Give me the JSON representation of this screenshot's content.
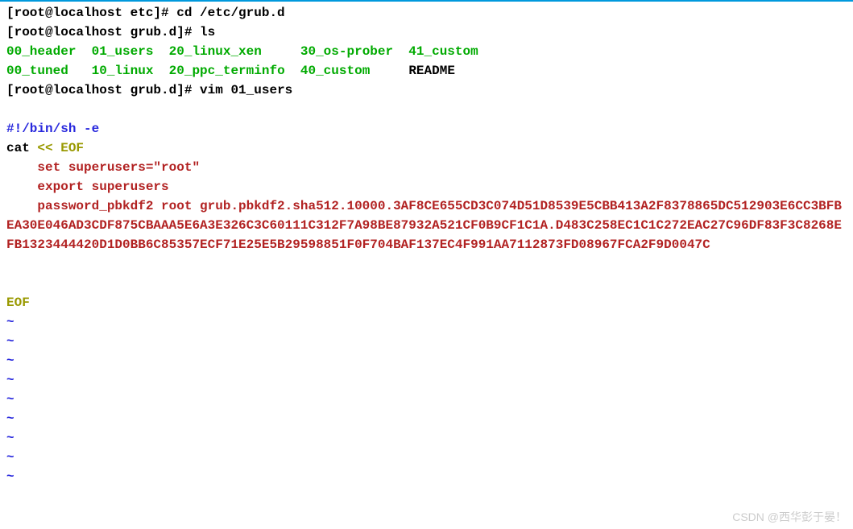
{
  "prompts": {
    "line1_prompt": "[root@localhost etc]# ",
    "line1_cmd": "cd /etc/grub.d",
    "line2_prompt": "[root@localhost grub.d]# ",
    "line2_cmd": "ls",
    "line5_prompt": "[root@localhost grub.d]# ",
    "line5_cmd": "vim 01_users"
  },
  "ls_output": {
    "row1_col1": "00_header",
    "row1_col2": "01_users",
    "row1_col3": "20_linux_xen",
    "row1_col4": "30_os-prober",
    "row1_col5": "41_custom",
    "row2_col1": "00_tuned",
    "row2_col2": "10_linux",
    "row2_col3": "20_ppc_terminfo",
    "row2_col4": "40_custom",
    "row2_col5": "README"
  },
  "file": {
    "shebang": "#!/bin/sh -e",
    "cat": "cat ",
    "heredoc_start": "<< EOF",
    "line1": "    set superusers=\"root\"",
    "line2": "    export superusers",
    "hash_wrapped": "    password_pbkdf2 root grub.pbkdf2.sha512.10000.3AF8CE655CD3C074D51D8539E5CBB413A2F8378865DC512903E6CC3BFBEA30E046AD3CDF875CBAAA5E6A3E326C3C60111C312F7A98BE87932A521CF0B9CF1C1A.D483C258EC1C1C272EAC27C96DF83F3C8268EFB1323444420D1D0BB6C85357ECF71E25E5B29598851F0F704BAF137EC4F991AA7112873FD08967FCA2F9D0047C",
    "eof": "EOF"
  },
  "tilde": "~",
  "watermark": "CSDN @西华彭于晏！"
}
